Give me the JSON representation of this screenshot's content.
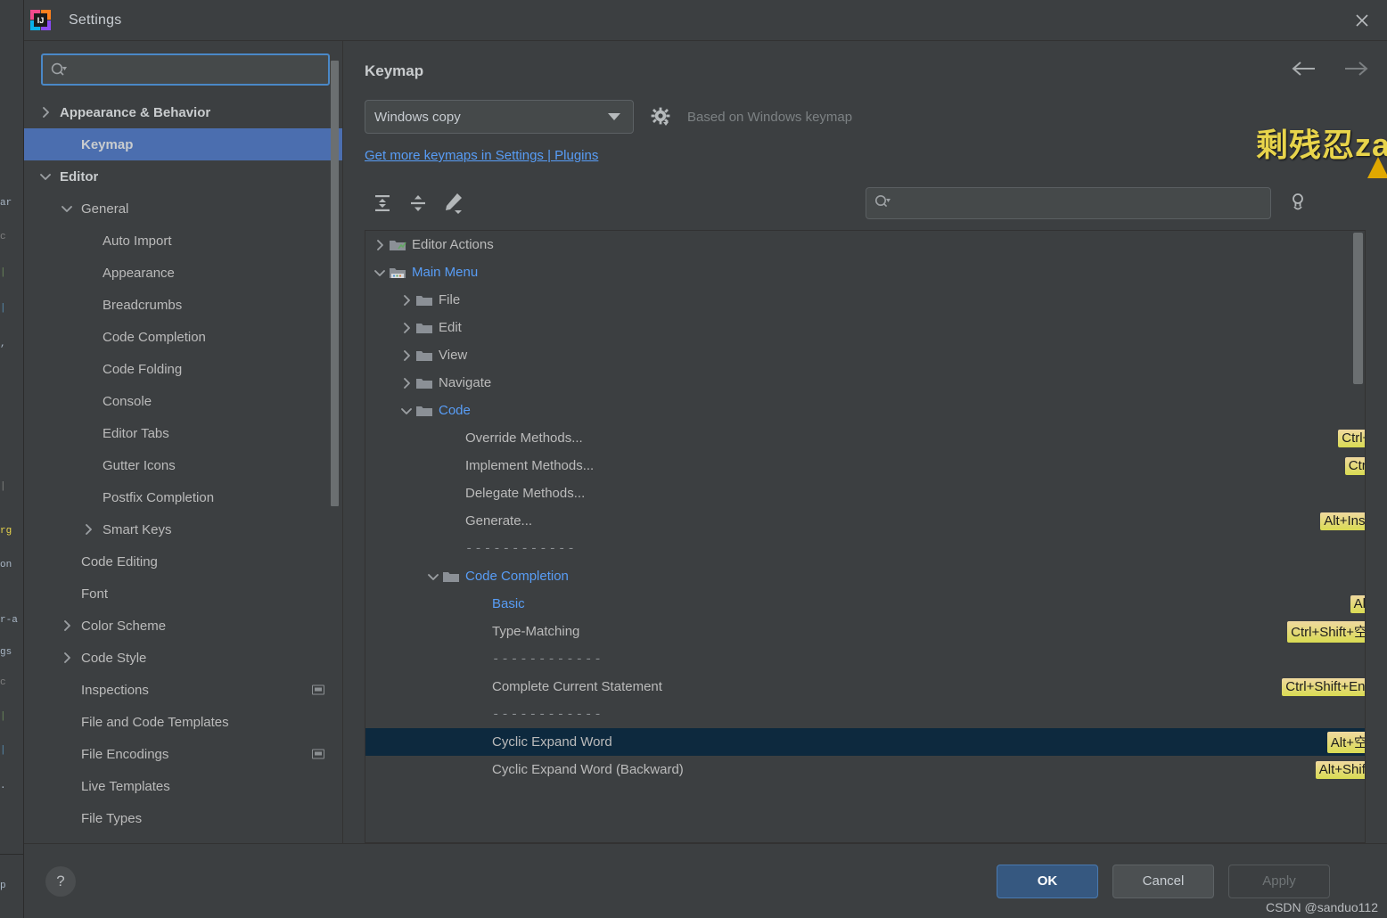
{
  "window": {
    "title": "Settings",
    "logo_name": "intellij-idea-logo",
    "close_label": "×"
  },
  "sidebar": {
    "search": {
      "value": "",
      "placeholder": ""
    },
    "items": [
      {
        "label": "Appearance & Behavior",
        "indent": 0,
        "arrow": "right",
        "bold": true,
        "selected": false,
        "badge": false
      },
      {
        "label": "Keymap",
        "indent": 1,
        "arrow": "none",
        "bold": true,
        "selected": true,
        "badge": false
      },
      {
        "label": "Editor",
        "indent": 0,
        "arrow": "down",
        "bold": true,
        "selected": false,
        "badge": false
      },
      {
        "label": "General",
        "indent": 1,
        "arrow": "down",
        "bold": false,
        "selected": false,
        "badge": false
      },
      {
        "label": "Auto Import",
        "indent": 2,
        "arrow": "none",
        "bold": false,
        "selected": false,
        "badge": false
      },
      {
        "label": "Appearance",
        "indent": 2,
        "arrow": "none",
        "bold": false,
        "selected": false,
        "badge": false
      },
      {
        "label": "Breadcrumbs",
        "indent": 2,
        "arrow": "none",
        "bold": false,
        "selected": false,
        "badge": false
      },
      {
        "label": "Code Completion",
        "indent": 2,
        "arrow": "none",
        "bold": false,
        "selected": false,
        "badge": false
      },
      {
        "label": "Code Folding",
        "indent": 2,
        "arrow": "none",
        "bold": false,
        "selected": false,
        "badge": false
      },
      {
        "label": "Console",
        "indent": 2,
        "arrow": "none",
        "bold": false,
        "selected": false,
        "badge": false
      },
      {
        "label": "Editor Tabs",
        "indent": 2,
        "arrow": "none",
        "bold": false,
        "selected": false,
        "badge": false
      },
      {
        "label": "Gutter Icons",
        "indent": 2,
        "arrow": "none",
        "bold": false,
        "selected": false,
        "badge": false
      },
      {
        "label": "Postfix Completion",
        "indent": 2,
        "arrow": "none",
        "bold": false,
        "selected": false,
        "badge": false
      },
      {
        "label": "Smart Keys",
        "indent": 2,
        "arrow": "right",
        "bold": false,
        "selected": false,
        "badge": false
      },
      {
        "label": "Code Editing",
        "indent": 1,
        "arrow": "none",
        "bold": false,
        "selected": false,
        "badge": false
      },
      {
        "label": "Font",
        "indent": 1,
        "arrow": "none",
        "bold": false,
        "selected": false,
        "badge": false
      },
      {
        "label": "Color Scheme",
        "indent": 1,
        "arrow": "right",
        "bold": false,
        "selected": false,
        "badge": false
      },
      {
        "label": "Code Style",
        "indent": 1,
        "arrow": "right",
        "bold": false,
        "selected": false,
        "badge": false
      },
      {
        "label": "Inspections",
        "indent": 1,
        "arrow": "none",
        "bold": false,
        "selected": false,
        "badge": true
      },
      {
        "label": "File and Code Templates",
        "indent": 1,
        "arrow": "none",
        "bold": false,
        "selected": false,
        "badge": false
      },
      {
        "label": "File Encodings",
        "indent": 1,
        "arrow": "none",
        "bold": false,
        "selected": false,
        "badge": true
      },
      {
        "label": "Live Templates",
        "indent": 1,
        "arrow": "none",
        "bold": false,
        "selected": false,
        "badge": false
      },
      {
        "label": "File Types",
        "indent": 1,
        "arrow": "none",
        "bold": false,
        "selected": false,
        "badge": false
      }
    ]
  },
  "content": {
    "page_title": "Keymap",
    "nav_back_icon": "arrow-left-icon",
    "nav_forward_icon": "arrow-right-icon",
    "keymap_select": {
      "value": "Windows copy",
      "options": [
        "Windows copy"
      ]
    },
    "gear_icon": "gear-icon",
    "based_on": "Based on Windows keymap",
    "plugins_link": "Get more keymaps in Settings | Plugins",
    "toolbar": {
      "expand_all": "expand-all-icon",
      "collapse_all": "collapse-all-icon",
      "edit_shortcut": "edit-pencil-icon",
      "find_by_shortcut": "find-by-shortcut-icon",
      "search": {
        "value": "",
        "placeholder": ""
      }
    },
    "overlay_text": "剩残忍za"
  },
  "keymap_tree": [
    {
      "label": "Editor Actions",
      "indent": 0,
      "arrow": "right",
      "icon": "editor-actions-icon",
      "link": false,
      "sep": false,
      "selected": false,
      "shortcut": ""
    },
    {
      "label": "Main Menu",
      "indent": 0,
      "arrow": "down",
      "icon": "main-menu-icon",
      "link": true,
      "sep": false,
      "selected": false,
      "shortcut": ""
    },
    {
      "label": "File",
      "indent": 1,
      "arrow": "right",
      "icon": "folder-icon",
      "link": false,
      "sep": false,
      "selected": false,
      "shortcut": ""
    },
    {
      "label": "Edit",
      "indent": 1,
      "arrow": "right",
      "icon": "folder-icon",
      "link": false,
      "sep": false,
      "selected": false,
      "shortcut": ""
    },
    {
      "label": "View",
      "indent": 1,
      "arrow": "right",
      "icon": "folder-icon",
      "link": false,
      "sep": false,
      "selected": false,
      "shortcut": ""
    },
    {
      "label": "Navigate",
      "indent": 1,
      "arrow": "right",
      "icon": "folder-icon",
      "link": false,
      "sep": false,
      "selected": false,
      "shortcut": ""
    },
    {
      "label": "Code",
      "indent": 1,
      "arrow": "down",
      "icon": "folder-icon",
      "link": true,
      "sep": false,
      "selected": false,
      "shortcut": ""
    },
    {
      "label": "Override Methods...",
      "indent": 2,
      "arrow": "none",
      "icon": "none",
      "link": false,
      "sep": false,
      "selected": false,
      "shortcut": "Ctrl+O"
    },
    {
      "label": "Implement Methods...",
      "indent": 2,
      "arrow": "none",
      "icon": "none",
      "link": false,
      "sep": false,
      "selected": false,
      "shortcut": "Ctrl+I"
    },
    {
      "label": "Delegate Methods...",
      "indent": 2,
      "arrow": "none",
      "icon": "none",
      "link": false,
      "sep": false,
      "selected": false,
      "shortcut": ""
    },
    {
      "label": "Generate...",
      "indent": 2,
      "arrow": "none",
      "icon": "none",
      "link": false,
      "sep": false,
      "selected": false,
      "shortcut": "Alt+Insert"
    },
    {
      "label": "------------",
      "indent": 2,
      "arrow": "none",
      "icon": "none",
      "link": false,
      "sep": true,
      "selected": false,
      "shortcut": ""
    },
    {
      "label": "Code Completion",
      "indent": 2,
      "arrow": "down",
      "icon": "folder-icon",
      "link": true,
      "sep": false,
      "selected": false,
      "shortcut": ""
    },
    {
      "label": "Basic",
      "indent": 3,
      "arrow": "none",
      "icon": "none",
      "link": true,
      "sep": false,
      "selected": false,
      "shortcut": "Alt+/"
    },
    {
      "label": "Type-Matching",
      "indent": 3,
      "arrow": "none",
      "icon": "none",
      "link": false,
      "sep": false,
      "selected": false,
      "shortcut": "Ctrl+Shift+空格"
    },
    {
      "label": "------------",
      "indent": 3,
      "arrow": "none",
      "icon": "none",
      "link": false,
      "sep": true,
      "selected": false,
      "shortcut": ""
    },
    {
      "label": "Complete Current Statement",
      "indent": 3,
      "arrow": "none",
      "icon": "none",
      "link": false,
      "sep": false,
      "selected": false,
      "shortcut": "Ctrl+Shift+Enter"
    },
    {
      "label": "------------",
      "indent": 3,
      "arrow": "none",
      "icon": "none",
      "link": false,
      "sep": true,
      "selected": false,
      "shortcut": ""
    },
    {
      "label": "Cyclic Expand Word",
      "indent": 3,
      "arrow": "none",
      "icon": "none",
      "link": false,
      "sep": false,
      "selected": true,
      "shortcut": "Alt+空格"
    },
    {
      "label": "Cyclic Expand Word (Backward)",
      "indent": 3,
      "arrow": "none",
      "icon": "none",
      "link": false,
      "sep": false,
      "selected": false,
      "shortcut": "Alt+Shift+/"
    }
  ],
  "footer": {
    "help_label": "?",
    "ok_label": "OK",
    "cancel_label": "Cancel",
    "apply_label": "Apply",
    "watermark": "CSDN @sanduo112"
  },
  "colors": {
    "accent_blue": "#4b6eaf",
    "link_blue": "#589df6",
    "selection_dark": "#0d293e",
    "shortcut_yellow": "#d9db52",
    "panel_bg": "#3c3f41",
    "field_bg": "#45494a",
    "overlay_yellow": "#e8d44b"
  }
}
